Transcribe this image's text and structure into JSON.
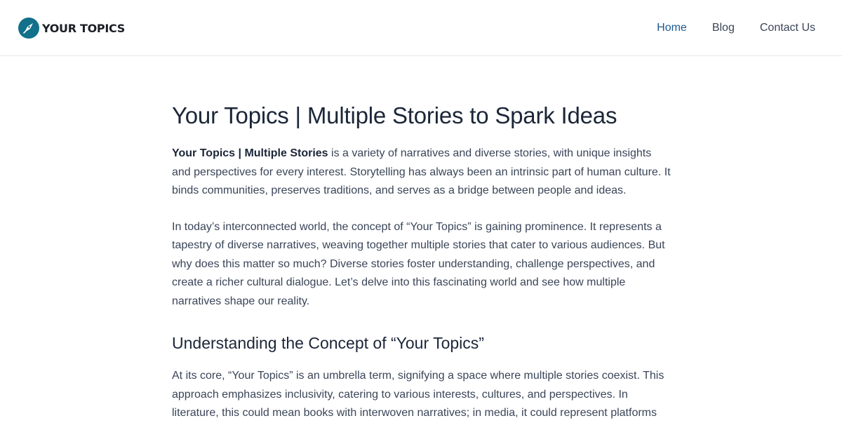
{
  "header": {
    "logo_text": "YOUR TOPICS",
    "logo_icon": "pen-nib-icon",
    "brand_color": "#12708a",
    "nav": [
      {
        "label": "Home",
        "active": true
      },
      {
        "label": "Blog",
        "active": false
      },
      {
        "label": "Contact Us",
        "active": false
      }
    ]
  },
  "article": {
    "title": "Your Topics | Multiple Stories to Spark Ideas",
    "intro": {
      "bold_lead": "Your Topics | Multiple Stories",
      "rest": " is a variety of narratives and diverse stories, with unique insights and perspectives for every interest. Storytelling has always been an intrinsic part of human culture. It binds communities, preserves traditions, and serves as a bridge between people and ideas."
    },
    "paragraph_2": "In today’s interconnected world, the concept of “Your Topics” is gaining prominence. It represents a tapestry of diverse narratives, weaving together multiple stories that cater to various audiences. But why does this matter so much? Diverse stories foster understanding, challenge perspectives, and create a richer cultural dialogue. Let’s delve into this fascinating world and see how multiple narratives shape our reality.",
    "section_heading": "Understanding the Concept of “Your Topics”",
    "paragraph_3": "At its core, “Your Topics” is an umbrella term, signifying a space where multiple stories coexist. This approach emphasizes inclusivity, catering to various interests, cultures, and perspectives. In literature, this could mean books with interwoven narratives; in media, it could represent platforms"
  },
  "colors": {
    "text": "#3a4558",
    "heading": "#1b2638",
    "nav_active": "#1d5a8f",
    "divider": "#e6e8eb"
  }
}
